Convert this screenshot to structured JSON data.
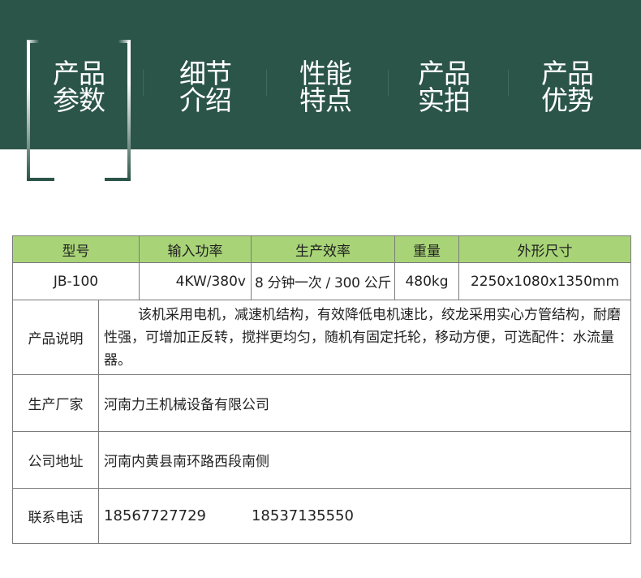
{
  "nav": {
    "items": [
      {
        "line1": "产品",
        "line2": "参数"
      },
      {
        "line1": "细节",
        "line2": "介绍"
      },
      {
        "line1": "性能",
        "line2": "特点"
      },
      {
        "line1": "产品",
        "line2": "实拍"
      },
      {
        "line1": "产品",
        "line2": "优势"
      }
    ],
    "active_index": 0
  },
  "colors": {
    "banner": "#2c5549",
    "header_row": "#a8d477",
    "border": "#7b7b7b"
  },
  "spec_table": {
    "headers": [
      "型号",
      "输入功率",
      "生产效率",
      "重量",
      "外形尺寸"
    ],
    "values": [
      "JB-100",
      "4KW/380v",
      "8 分钟一次 / 300 公斤",
      "480kg",
      "2250x1080x1350mm"
    ]
  },
  "info": {
    "description_label": "产品说明",
    "description": "该机采用电机，减速机结构，有效降低电机速比，绞龙采用实心方管结构，耐磨性强，可增加正反转，搅拌更均匀，随机有固定托轮，移动方便，可选配件：水流量器。",
    "manufacturer_label": "生产厂家",
    "manufacturer": "河南力王机械设备有限公司",
    "address_label": "公司地址",
    "address": "河南内黄县南环路西段南侧",
    "phone_label": "联系电话",
    "phone1": "18567727729",
    "phone2": "18537135550"
  }
}
